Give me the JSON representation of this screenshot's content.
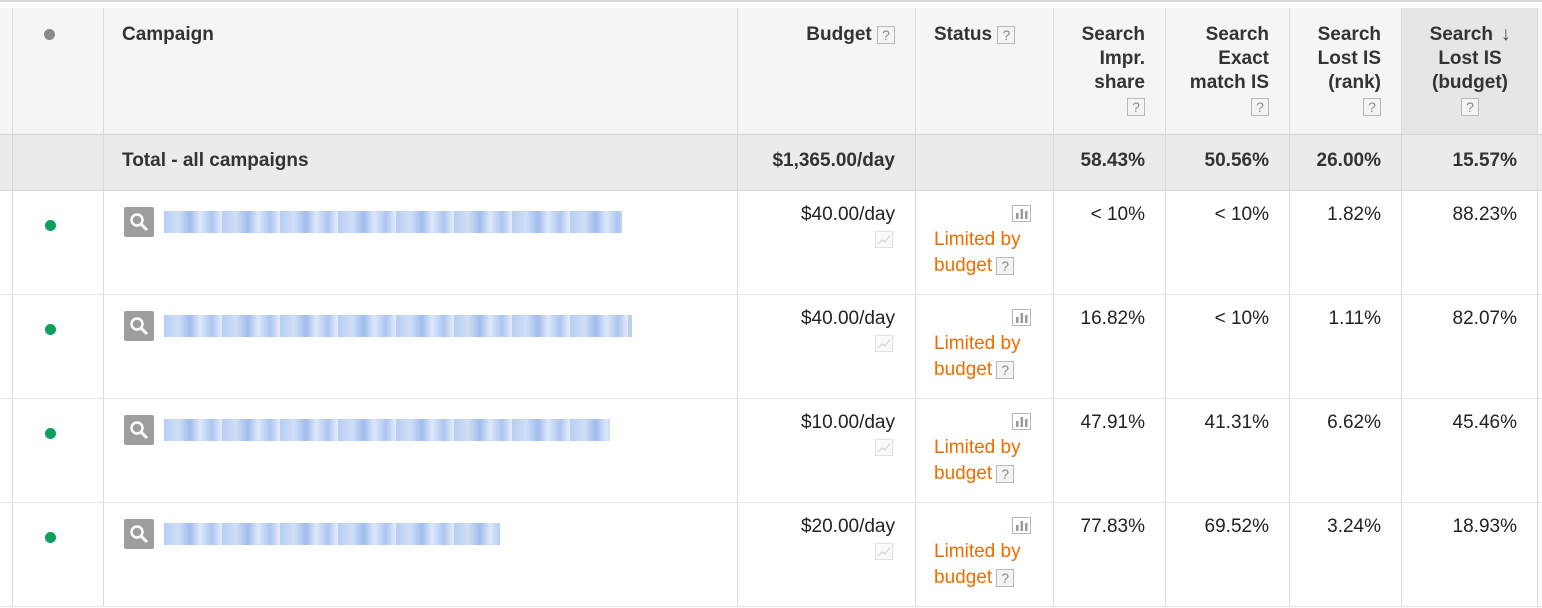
{
  "header": {
    "campaign": "Campaign",
    "budget": "Budget",
    "status": "Status",
    "impr_share": [
      "Search",
      "Impr.",
      "share"
    ],
    "exact_match": [
      "Search",
      "Exact",
      "match IS"
    ],
    "lost_rank": [
      "Search",
      "Lost IS",
      "(rank)"
    ],
    "lost_budget": [
      "Search",
      "Lost IS",
      "(budget)"
    ],
    "help": "?",
    "sort_indicator": "↓"
  },
  "total": {
    "label": "Total - all campaigns",
    "budget": "$1,365.00/day",
    "impr_share": "58.43%",
    "exact_match": "50.56%",
    "lost_rank": "26.00%",
    "lost_budget": "15.57%"
  },
  "rows": [
    {
      "budget": "$40.00/day",
      "status": "Limited by",
      "status2": "budget",
      "impr_share": "< 10%",
      "exact_match": "< 10%",
      "lost_rank": "1.82%",
      "lost_budget": "88.23%"
    },
    {
      "budget": "$40.00/day",
      "status": "Limited by",
      "status2": "budget",
      "impr_share": "16.82%",
      "exact_match": "< 10%",
      "lost_rank": "1.11%",
      "lost_budget": "82.07%"
    },
    {
      "budget": "$10.00/day",
      "status": "Limited by",
      "status2": "budget",
      "impr_share": "47.91%",
      "exact_match": "41.31%",
      "lost_rank": "6.62%",
      "lost_budget": "45.46%"
    },
    {
      "budget": "$20.00/day",
      "status": "Limited by",
      "status2": "budget",
      "impr_share": "77.83%",
      "exact_match": "69.52%",
      "lost_rank": "3.24%",
      "lost_budget": "18.93%"
    }
  ],
  "colors": {
    "status_limited": "#ef6c00",
    "enabled_dot": "#0f9d58",
    "header_dot": "#8a8a8a"
  },
  "icons": {
    "header_status": "gray-dot-icon",
    "row_status": "green-dot-icon",
    "campaign_type": "search-icon",
    "status_chart": "bar-chart-icon",
    "budget_trend": "trend-chart-icon",
    "help": "help-icon",
    "sort": "sort-arrow-icon"
  }
}
